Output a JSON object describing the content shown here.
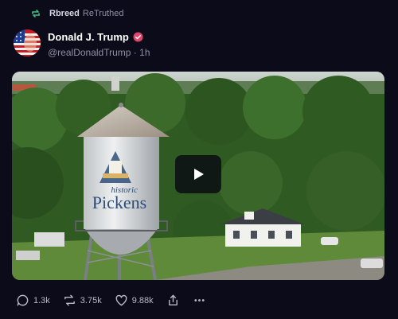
{
  "retruth": {
    "user": "Rbreed",
    "verb": "ReTruthed",
    "icon": "retruth-icon"
  },
  "author": {
    "name": "Donald J. Trump",
    "handle": "@realDonaldTrump",
    "separator": "·",
    "time": "1h",
    "verified_icon": "verified-badge-icon",
    "avatar": "flag-avatar"
  },
  "media": {
    "type": "video",
    "tower_text_top": "historic",
    "tower_text_main": "Pickens",
    "play_icon": "play-icon"
  },
  "actions": {
    "replies": "1.3k",
    "retruths": "3.75k",
    "likes": "9.88k"
  },
  "colors": {
    "background": "#0b0b1a",
    "accent": "#e0446b",
    "muted": "#8f8fa3"
  }
}
